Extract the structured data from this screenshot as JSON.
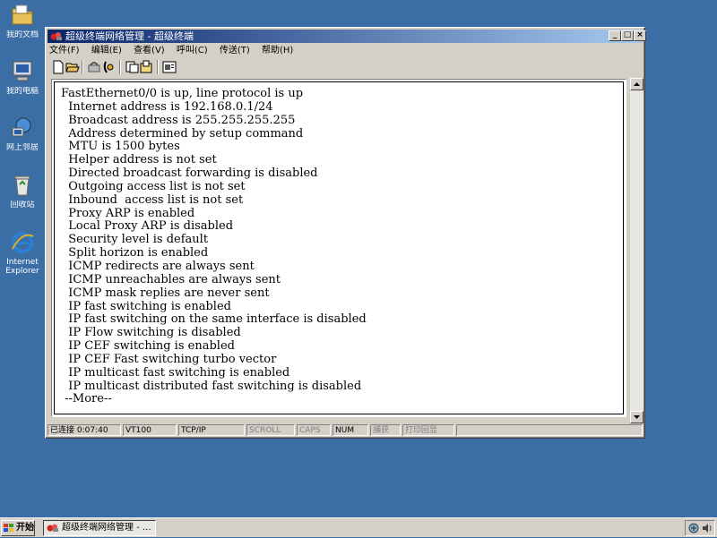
{
  "desktop": {
    "icons": [
      {
        "label": "我的文档",
        "icon": "my-documents-icon"
      },
      {
        "label": "我的电脑",
        "icon": "my-computer-icon"
      },
      {
        "label": "网上邻居",
        "icon": "network-places-icon"
      },
      {
        "label": "回收站",
        "icon": "recycle-bin-icon"
      },
      {
        "label": "Internet",
        "label2": "Explorer",
        "icon": "internet-explorer-icon"
      }
    ]
  },
  "window": {
    "title": "超级终端网络管理 - 超级终端",
    "title_bar_color": "#0a246a",
    "buttons": {
      "minimize": "_",
      "maximize": "□",
      "close": "×"
    }
  },
  "menu": {
    "items": [
      "文件(F)",
      "编辑(E)",
      "查看(V)",
      "呼叫(C)",
      "传送(T)",
      "帮助(H)"
    ]
  },
  "toolbar": {
    "icons": [
      "new-icon",
      "open-icon",
      "connect-icon",
      "disconnect-icon",
      "send-icon",
      "receive-icon",
      "properties-icon"
    ]
  },
  "terminal": {
    "lines": [
      "FastEthernet0/0 is up, line protocol is up",
      "  Internet address is 192.168.0.1/24",
      "  Broadcast address is 255.255.255.255",
      "  Address determined by setup command",
      "  MTU is 1500 bytes",
      "  Helper address is not set",
      "  Directed broadcast forwarding is disabled",
      "  Outgoing access list is not set",
      "  Inbound  access list is not set",
      "  Proxy ARP is enabled",
      "  Local Proxy ARP is disabled",
      "  Security level is default",
      "  Split horizon is enabled",
      "  ICMP redirects are always sent",
      "  ICMP unreachables are always sent",
      "  ICMP mask replies are never sent",
      "  IP fast switching is enabled",
      "  IP fast switching on the same interface is disabled",
      "  IP Flow switching is disabled",
      "  IP CEF switching is enabled",
      "  IP CEF Fast switching turbo vector",
      "  IP multicast fast switching is enabled",
      "  IP multicast distributed fast switching is disabled",
      " --More--"
    ]
  },
  "statusbar": {
    "connected": "已连接 0:07:40",
    "emulation": "VT100",
    "protocol": "TCP/IP",
    "scroll": "SCROLL",
    "caps": "CAPS",
    "num": "NUM",
    "capture": "捕获",
    "print_echo": "打印回显"
  },
  "taskbar": {
    "start_label": "开始",
    "task_label": "超级终端网络管理 - ..."
  },
  "colors": {
    "desktop": "#3a6ea5",
    "face": "#d4d0c8"
  }
}
